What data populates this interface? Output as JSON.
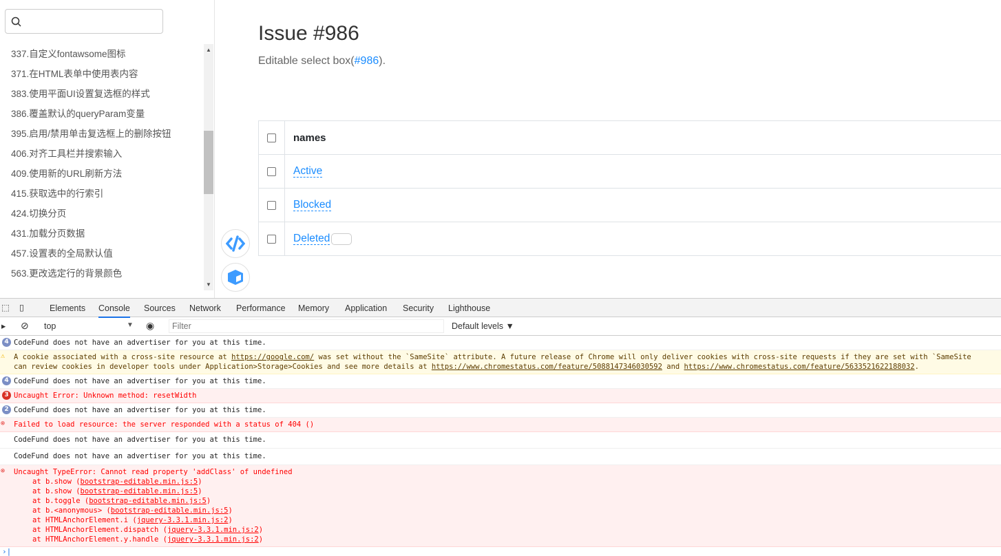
{
  "sidebar": {
    "search_placeholder": "",
    "items": [
      "337.自定义fontawsome图标",
      "371.在HTML表单中使用表内容",
      "383.使用平面UI设置复选框的样式",
      "386.覆盖默认的queryParam变量",
      "395.启用/禁用单击复选框上的删除按钮",
      "406.对齐工具栏并搜索输入",
      "409.使用新的URL刷新方法",
      "415.获取选中的行索引",
      "424.切换分页",
      "431.加载分页数据",
      "457.设置表的全局默认值",
      "563.更改选定行的背景颜色"
    ]
  },
  "main": {
    "title": "Issue #986",
    "subtitle_prefix": "Editable select box(",
    "subtitle_link": "#986",
    "subtitle_suffix": ").",
    "table": {
      "header": "names",
      "rows": [
        "Active",
        "Blocked",
        "Deleted"
      ]
    }
  },
  "devtools": {
    "tabs": [
      "Elements",
      "Console",
      "Sources",
      "Network",
      "Performance",
      "Memory",
      "Application",
      "Security",
      "Lighthouse"
    ],
    "active_tab": "Console",
    "context": "top",
    "filter_placeholder": "Filter",
    "levels": "Default levels ▼",
    "messages": [
      {
        "type": "info",
        "count": "4",
        "text": "CodeFund does not have an advertiser for you at this time."
      },
      {
        "type": "warn",
        "line1_a": "A cookie associated with a cross-site resource at ",
        "link1": "https://google.com/",
        "line1_b": " was set without the `SameSite` attribute. A future release of Chrome will only deliver cookies with cross-site requests if they are set with `SameSite",
        "line2_a": "can review cookies in developer tools under Application>Storage>Cookies and see more details at ",
        "link2": "https://www.chromestatus.com/feature/5088147346030592",
        "line2_b": " and ",
        "link3": "https://www.chromestatus.com/feature/5633521622188032",
        "line2_c": "."
      },
      {
        "type": "info",
        "count": "4",
        "text": "CodeFund does not have an advertiser for you at this time."
      },
      {
        "type": "error",
        "count": "3",
        "text": "Uncaught Error: Unknown method: resetWidth"
      },
      {
        "type": "info",
        "count": "2",
        "text": "CodeFund does not have an advertiser for you at this time."
      },
      {
        "type": "error",
        "text": "Failed to load resource: the server responded with a status of 404 ()"
      },
      {
        "type": "log",
        "text": "CodeFund does not have an advertiser for you at this time."
      },
      {
        "type": "log",
        "text": "CodeFund does not have an advertiser for you at this time."
      },
      {
        "type": "error",
        "text": "Uncaught TypeError: Cannot read property 'addClass' of undefined",
        "stack": [
          [
            "at b.show (",
            "bootstrap-editable.min.js:5",
            ")"
          ],
          [
            "at b.show (",
            "bootstrap-editable.min.js:5",
            ")"
          ],
          [
            "at b.toggle (",
            "bootstrap-editable.min.js:5",
            ")"
          ],
          [
            "at b.<anonymous> (",
            "bootstrap-editable.min.js:5",
            ")"
          ],
          [
            "at HTMLAnchorElement.i (",
            "jquery-3.3.1.min.js:2",
            ")"
          ],
          [
            "at HTMLAnchorElement.dispatch (",
            "jquery-3.3.1.min.js:2",
            ")"
          ],
          [
            "at HTMLAnchorElement.y.handle (",
            "jquery-3.3.1.min.js:2",
            ")"
          ]
        ]
      }
    ]
  },
  "colors": {
    "accent": "#1a8cff",
    "error": "#ff0000",
    "warn_bg": "#fffbe5",
    "error_bg": "#fff0f0"
  }
}
